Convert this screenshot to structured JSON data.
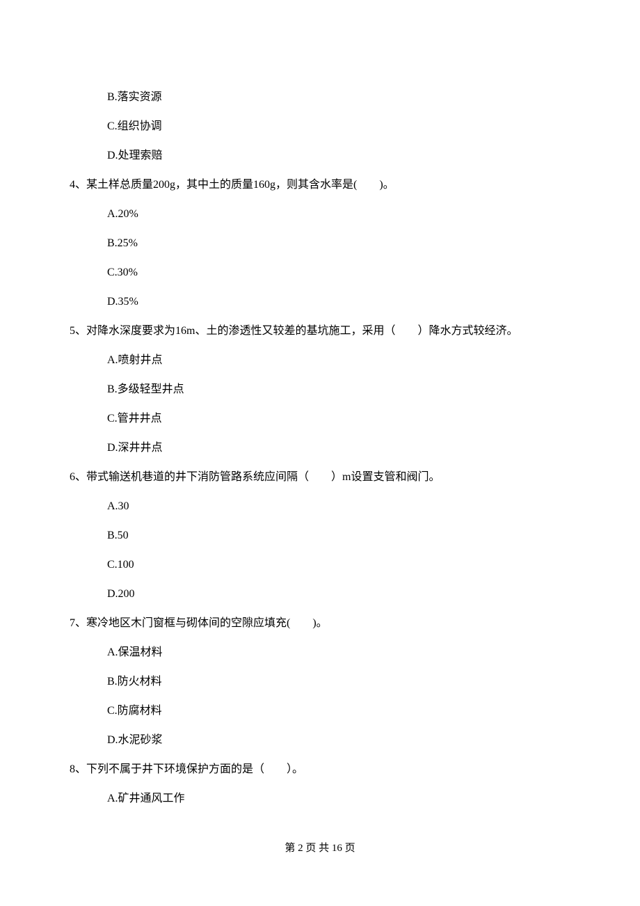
{
  "options_pre": [
    "B.落实资源",
    "C.组织协调",
    "D.处理索赔"
  ],
  "q4": {
    "text": "4、某土样总质量200g，其中土的质量160g，则其含水率是(　　)。",
    "options": [
      "A.20%",
      "B.25%",
      "C.30%",
      "D.35%"
    ]
  },
  "q5": {
    "text": "5、对降水深度要求为16m、土的渗透性又较差的基坑施工，采用（　　）降水方式较经济。",
    "options": [
      "A.喷射井点",
      "B.多级轻型井点",
      "C.管井井点",
      "D.深井井点"
    ]
  },
  "q6": {
    "text": "6、带式输送机巷道的井下消防管路系统应间隔（　　）m设置支管和阀门。",
    "options": [
      "A.30",
      "B.50",
      "C.100",
      "D.200"
    ]
  },
  "q7": {
    "text": "7、寒冷地区木门窗框与砌体间的空隙应填充(　　)。",
    "options": [
      "A.保温材料",
      "B.防火材料",
      "C.防腐材料",
      "D.水泥砂浆"
    ]
  },
  "q8": {
    "text": "8、下列不属于井下环境保护方面的是（　　）。",
    "options": [
      "A.矿井通风工作"
    ]
  },
  "footer": "第 2 页 共 16 页"
}
